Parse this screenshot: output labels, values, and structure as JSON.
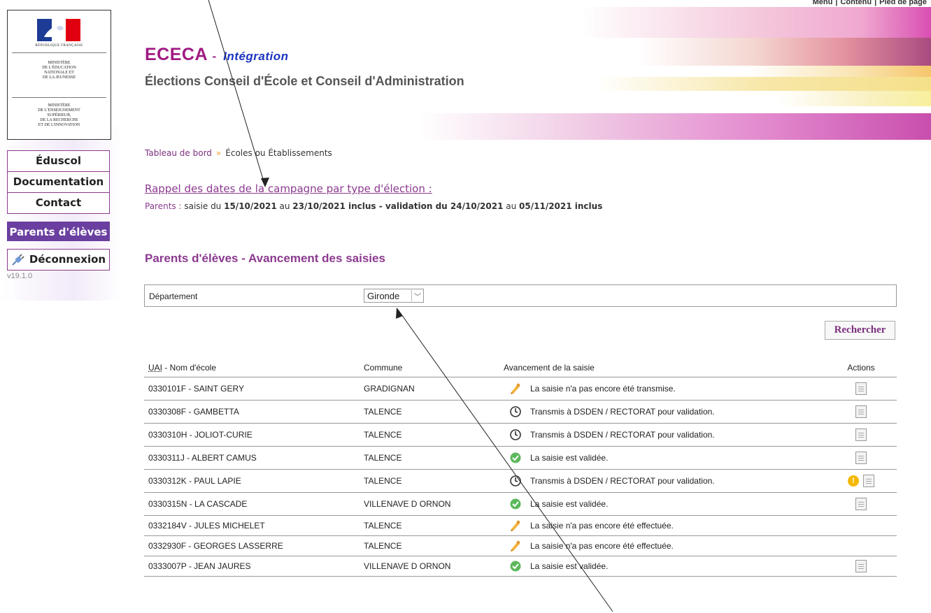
{
  "skip_links": [
    "Menu",
    "Contenu",
    "Pied de page"
  ],
  "logo": {
    "rf_text": "RÉPUBLIQUE FRANÇAISE",
    "ministry1": "MINISTÈRE\nDE L'ÉDUCATION\nNATIONALE ET\nDE LA JEUNESSE",
    "ministry2": "MINISTÈRE\nDE L'ENSEIGNEMENT\nSUPÉRIEUR,\nDE LA RECHERCHE\nET DE L'INNOVATION"
  },
  "header": {
    "app_name": "ECECA",
    "dash": "-",
    "env": "Intégration",
    "subtitle": "Élections Conseil d'École et Conseil d'Administration"
  },
  "side_menu": {
    "eduscol": "Éduscol",
    "documentation": "Documentation",
    "contact": "Contact",
    "parents": "Parents d'élèves",
    "logout": "Déconnexion",
    "version": "v19.1.0"
  },
  "breadcrumb": {
    "home": "Tableau de bord",
    "current": "Écoles ou Établissements"
  },
  "rappel": {
    "title": "Rappel des dates de la campagne par type d'élection :",
    "who": "Parents :",
    "t1": " saisie du ",
    "d1": "15/10/2021",
    "t2": " au ",
    "d2": "23/10/2021 inclus",
    "t3": " - validation du ",
    "d3": "24/10/2021",
    "t4": " au ",
    "d4": "05/11/2021 inclus"
  },
  "section_title": "Parents d'élèves - Avancement des saisies",
  "filter": {
    "label": "Département",
    "value": "Gironde"
  },
  "search_button": "Rechercher",
  "table": {
    "headers": {
      "uai": "UAI",
      "name": " - Nom d'école",
      "commune": "Commune",
      "status": "Avancement de la saisie",
      "actions": "Actions"
    },
    "rows": [
      {
        "school": "0330101F - SAINT GERY",
        "commune": "GRADIGNAN",
        "status": "La saisie n'a pas encore été transmise.",
        "icon": "pencil"
      },
      {
        "school": "0330308F - GAMBETTA",
        "commune": "TALENCE",
        "status": "Transmis à DSDEN / RECTORAT pour validation.",
        "icon": "clock"
      },
      {
        "school": "0330310H - JOLIOT-CURIE",
        "commune": "TALENCE",
        "status": "Transmis à DSDEN / RECTORAT pour validation.",
        "icon": "clock"
      },
      {
        "school": "0330311J - ALBERT CAMUS",
        "commune": "TALENCE",
        "status": "La saisie est validée.",
        "icon": "check"
      },
      {
        "school": "0330312K - PAUL LAPIE",
        "commune": "TALENCE",
        "status": "Transmis à DSDEN / RECTORAT pour validation.",
        "icon": "clock"
      },
      {
        "school": "0330315N - LA CASCADE",
        "commune": "VILLENAVE D ORNON",
        "status": "La saisie est validée.",
        "icon": "check"
      },
      {
        "school": "0332184V - JULES MICHELET",
        "commune": "TALENCE",
        "status": "La saisie n'a pas encore été effectuée.",
        "icon": "pencil"
      },
      {
        "school": "0332930F - GEORGES LASSERRE",
        "commune": "TALENCE",
        "status": "La saisie n'a pas encore été effectuée.",
        "icon": "pencil"
      },
      {
        "school": "0333007P - JEAN JAURES",
        "commune": "VILLENAVE D ORNON",
        "status": "La saisie est validée.",
        "icon": "check"
      }
    ]
  },
  "colors": {
    "brand": "#a01a82",
    "env": "#1b33c2",
    "active_menu": "#6a3fa0",
    "status_check": "#5cb85c",
    "status_pencil": "#f0b030",
    "warning": "#f5b800"
  }
}
